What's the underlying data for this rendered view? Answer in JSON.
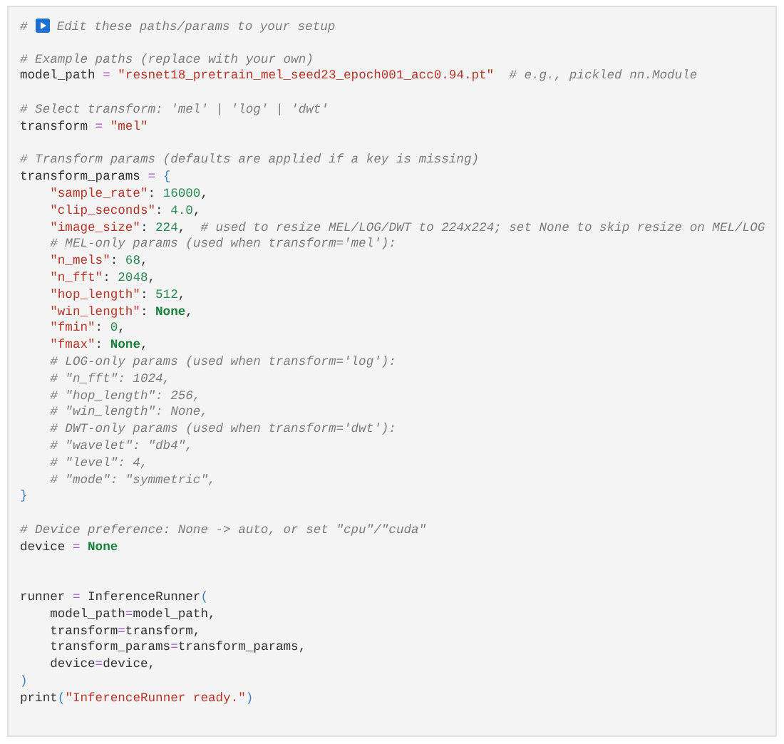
{
  "code_cell": {
    "lines": [
      {
        "kind": "code",
        "tokens": [
          {
            "kind": "comment",
            "text": "# "
          },
          {
            "kind": "icon"
          },
          {
            "kind": "comment",
            "text": " Edit these paths/params to your setup"
          }
        ]
      },
      {
        "kind": "blank"
      },
      {
        "kind": "code",
        "tokens": [
          {
            "kind": "comment",
            "text": "# Example paths (replace with your own)"
          }
        ]
      },
      {
        "kind": "code",
        "tokens": [
          {
            "kind": "plain",
            "text": "model_path"
          },
          {
            "kind": "op",
            "text": " = "
          },
          {
            "kind": "string",
            "text": "\"resnet18_pretrain_mel_seed23_epoch001_acc0.94.pt\""
          },
          {
            "kind": "comment",
            "text": "  # e.g., pickled nn.Module"
          }
        ]
      },
      {
        "kind": "blank"
      },
      {
        "kind": "code",
        "tokens": [
          {
            "kind": "comment",
            "text": "# Select transform: 'mel' | 'log' | 'dwt'"
          }
        ]
      },
      {
        "kind": "code",
        "tokens": [
          {
            "kind": "plain",
            "text": "transform"
          },
          {
            "kind": "op",
            "text": " = "
          },
          {
            "kind": "string",
            "text": "\"mel\""
          }
        ]
      },
      {
        "kind": "blank"
      },
      {
        "kind": "code",
        "tokens": [
          {
            "kind": "comment",
            "text": "# Transform params (defaults are applied if a key is missing)"
          }
        ]
      },
      {
        "kind": "code",
        "tokens": [
          {
            "kind": "plain",
            "text": "transform_params"
          },
          {
            "kind": "op",
            "text": " = "
          },
          {
            "kind": "punct",
            "text": "{"
          }
        ]
      },
      {
        "kind": "code",
        "tokens": [
          {
            "kind": "string",
            "text": "    \"sample_rate\""
          },
          {
            "kind": "plain",
            "text": ": "
          },
          {
            "kind": "number",
            "text": "16000"
          },
          {
            "kind": "plain",
            "text": ","
          }
        ]
      },
      {
        "kind": "code",
        "tokens": [
          {
            "kind": "string",
            "text": "    \"clip_seconds\""
          },
          {
            "kind": "plain",
            "text": ": "
          },
          {
            "kind": "number",
            "text": "4.0"
          },
          {
            "kind": "plain",
            "text": ","
          }
        ]
      },
      {
        "kind": "code",
        "tokens": [
          {
            "kind": "string",
            "text": "    \"image_size\""
          },
          {
            "kind": "plain",
            "text": ": "
          },
          {
            "kind": "number",
            "text": "224"
          },
          {
            "kind": "plain",
            "text": ","
          },
          {
            "kind": "comment",
            "text": "  # used to resize MEL/LOG/DWT to 224x224; set None to skip resize on MEL/LOG"
          }
        ]
      },
      {
        "kind": "code",
        "tokens": [
          {
            "kind": "comment",
            "text": "    # MEL-only params (used when transform='mel'):"
          }
        ]
      },
      {
        "kind": "code",
        "tokens": [
          {
            "kind": "string",
            "text": "    \"n_mels\""
          },
          {
            "kind": "plain",
            "text": ": "
          },
          {
            "kind": "number",
            "text": "68"
          },
          {
            "kind": "plain",
            "text": ","
          }
        ]
      },
      {
        "kind": "code",
        "tokens": [
          {
            "kind": "string",
            "text": "    \"n_fft\""
          },
          {
            "kind": "plain",
            "text": ": "
          },
          {
            "kind": "number",
            "text": "2048"
          },
          {
            "kind": "plain",
            "text": ","
          }
        ]
      },
      {
        "kind": "code",
        "tokens": [
          {
            "kind": "string",
            "text": "    \"hop_length\""
          },
          {
            "kind": "plain",
            "text": ": "
          },
          {
            "kind": "number",
            "text": "512"
          },
          {
            "kind": "plain",
            "text": ","
          }
        ]
      },
      {
        "kind": "code",
        "tokens": [
          {
            "kind": "string",
            "text": "    \"win_length\""
          },
          {
            "kind": "plain",
            "text": ": "
          },
          {
            "kind": "keyword",
            "text": "None"
          },
          {
            "kind": "plain",
            "text": ","
          }
        ]
      },
      {
        "kind": "code",
        "tokens": [
          {
            "kind": "string",
            "text": "    \"fmin\""
          },
          {
            "kind": "plain",
            "text": ": "
          },
          {
            "kind": "number",
            "text": "0"
          },
          {
            "kind": "plain",
            "text": ","
          }
        ]
      },
      {
        "kind": "code",
        "tokens": [
          {
            "kind": "string",
            "text": "    \"fmax\""
          },
          {
            "kind": "plain",
            "text": ": "
          },
          {
            "kind": "keyword",
            "text": "None"
          },
          {
            "kind": "plain",
            "text": ","
          }
        ]
      },
      {
        "kind": "code",
        "tokens": [
          {
            "kind": "comment",
            "text": "    # LOG-only params (used when transform='log'):"
          }
        ]
      },
      {
        "kind": "code",
        "tokens": [
          {
            "kind": "comment",
            "text": "    # \"n_fft\": 1024,"
          }
        ]
      },
      {
        "kind": "code",
        "tokens": [
          {
            "kind": "comment",
            "text": "    # \"hop_length\": 256,"
          }
        ]
      },
      {
        "kind": "code",
        "tokens": [
          {
            "kind": "comment",
            "text": "    # \"win_length\": None,"
          }
        ]
      },
      {
        "kind": "code",
        "tokens": [
          {
            "kind": "comment",
            "text": "    # DWT-only params (used when transform='dwt'):"
          }
        ]
      },
      {
        "kind": "code",
        "tokens": [
          {
            "kind": "comment",
            "text": "    # \"wavelet\": \"db4\","
          }
        ]
      },
      {
        "kind": "code",
        "tokens": [
          {
            "kind": "comment",
            "text": "    # \"level\": 4,"
          }
        ]
      },
      {
        "kind": "code",
        "tokens": [
          {
            "kind": "comment",
            "text": "    # \"mode\": \"symmetric\","
          }
        ]
      },
      {
        "kind": "code",
        "tokens": [
          {
            "kind": "punct",
            "text": "}"
          }
        ]
      },
      {
        "kind": "blank"
      },
      {
        "kind": "code",
        "tokens": [
          {
            "kind": "comment",
            "text": "# Device preference: None -> auto, or set \"cpu\"/\"cuda\""
          }
        ]
      },
      {
        "kind": "code",
        "tokens": [
          {
            "kind": "plain",
            "text": "device"
          },
          {
            "kind": "op",
            "text": " = "
          },
          {
            "kind": "keyword",
            "text": "None"
          }
        ]
      },
      {
        "kind": "blank"
      },
      {
        "kind": "blank"
      },
      {
        "kind": "code",
        "tokens": [
          {
            "kind": "plain",
            "text": "runner"
          },
          {
            "kind": "op",
            "text": " = "
          },
          {
            "kind": "plain",
            "text": "InferenceRunner"
          },
          {
            "kind": "punct",
            "text": "("
          }
        ]
      },
      {
        "kind": "code",
        "tokens": [
          {
            "kind": "plain",
            "text": "    model_path"
          },
          {
            "kind": "op",
            "text": "="
          },
          {
            "kind": "plain",
            "text": "model_path,"
          }
        ]
      },
      {
        "kind": "code",
        "tokens": [
          {
            "kind": "plain",
            "text": "    transform"
          },
          {
            "kind": "op",
            "text": "="
          },
          {
            "kind": "plain",
            "text": "transform,"
          }
        ]
      },
      {
        "kind": "code",
        "tokens": [
          {
            "kind": "plain",
            "text": "    transform_params"
          },
          {
            "kind": "op",
            "text": "="
          },
          {
            "kind": "plain",
            "text": "transform_params,"
          }
        ]
      },
      {
        "kind": "code",
        "tokens": [
          {
            "kind": "plain",
            "text": "    device"
          },
          {
            "kind": "op",
            "text": "="
          },
          {
            "kind": "plain",
            "text": "device,"
          }
        ]
      },
      {
        "kind": "code",
        "tokens": [
          {
            "kind": "punct",
            "text": ")"
          }
        ]
      },
      {
        "kind": "code",
        "tokens": [
          {
            "kind": "plain",
            "text": "print"
          },
          {
            "kind": "punct",
            "text": "("
          },
          {
            "kind": "string",
            "text": "\"InferenceRunner ready.\""
          },
          {
            "kind": "punct",
            "text": ")"
          }
        ]
      }
    ]
  }
}
